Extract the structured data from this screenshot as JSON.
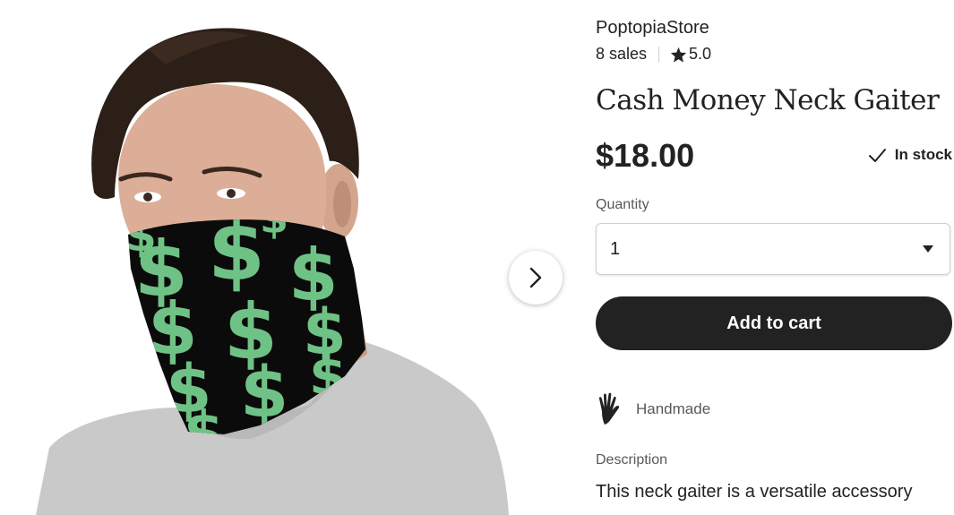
{
  "gallery": {
    "image_alt": "Man wearing a black neck gaiter printed with green dollar signs",
    "next_icon": "chevron-right-icon"
  },
  "listing": {
    "shop_name": "PoptopiaStore",
    "sales": "8 sales",
    "rating": "5.0",
    "rating_icon": "star-icon",
    "title": "Cash Money Neck Gaiter",
    "price": "$18.00",
    "stock_status": "In stock",
    "stock_icon": "checkmark-icon",
    "quantity_label": "Quantity",
    "quantity_value": "1",
    "quantity_icon": "caret-down-icon",
    "add_to_cart_label": "Add to cart",
    "handmade_label": "Handmade",
    "handmade_icon": "hand-icon",
    "description_label": "Description",
    "description_text": "This neck gaiter is a versatile accessory"
  },
  "colors": {
    "accent_dark": "#222222",
    "muted_text": "#595959",
    "dollar_green": "#6fc285",
    "gaiter_black": "#0b0b0b"
  }
}
